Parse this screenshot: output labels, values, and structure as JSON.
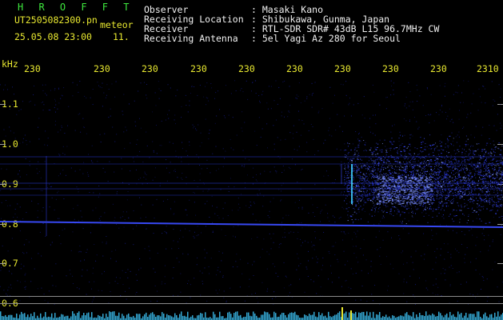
{
  "app": {
    "name": "H R O F F T"
  },
  "file": {
    "name": "UT2505082300.pn",
    "type": "meteor"
  },
  "datetime": {
    "text": "25.05.08 23:00",
    "count": "11."
  },
  "info": [
    {
      "label": "Observer",
      "value": ": Masaki Kano"
    },
    {
      "label": "Receiving Location",
      "value": ": Shibukawa, Gunma, Japan"
    },
    {
      "label": "Receiver",
      "value": ": RTL-SDR SDR# 43dB L15 96.7MHz CW"
    },
    {
      "label": "Receiving Antenna",
      "value": ": 5el Yagi Az 280 for Seoul"
    }
  ],
  "axis": {
    "unit": "kHz",
    "time_ticks": [
      "230",
      "230",
      "230",
      "230",
      "230",
      "230",
      "230",
      "230",
      "230",
      "2310"
    ],
    "freq_ticks": [
      "1.1",
      "1.0",
      "0.9",
      "0.8",
      "0.7",
      "0.6"
    ]
  },
  "colors": {
    "header_text": "#f0f0f0",
    "app_title": "#3ee83e",
    "axis_labels": "#e8e830",
    "signal": "#3a4cff",
    "baseline": "#8a8a8a",
    "noise_bars": "#3ab8e8"
  }
}
